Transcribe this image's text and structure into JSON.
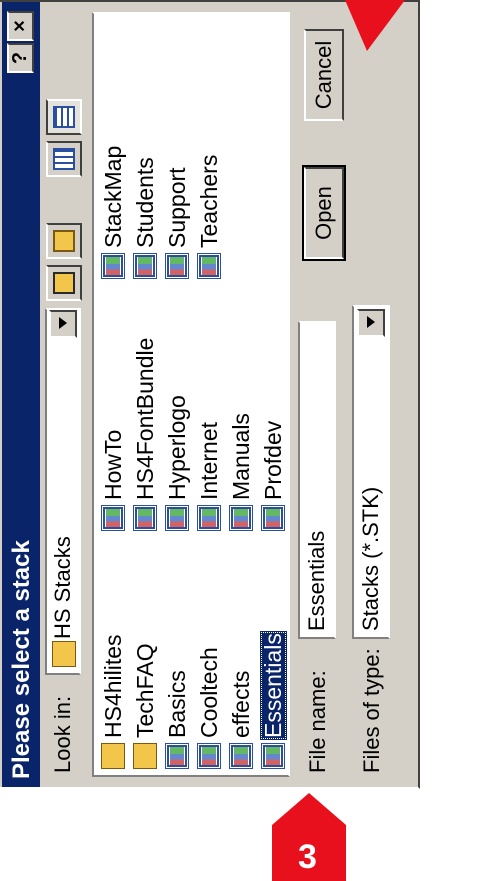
{
  "dialog": {
    "title": "Please select a stack",
    "help_button": "?",
    "close_button": "×"
  },
  "look_in": {
    "label": "Look in:",
    "value": "HS Stacks"
  },
  "toolbar": {
    "icons": [
      "up-one-level-icon",
      "create-new-folder-icon",
      "list-view-icon",
      "details-view-icon"
    ]
  },
  "files": {
    "column1": [
      {
        "name": "HS4hilites",
        "type": "folder"
      },
      {
        "name": "TechFAQ",
        "type": "folder"
      },
      {
        "name": "Basics",
        "type": "stack"
      },
      {
        "name": "Cooltech",
        "type": "stack"
      },
      {
        "name": "effects",
        "type": "stack"
      },
      {
        "name": "Essentials",
        "type": "stack",
        "selected": true
      }
    ],
    "column2": [
      {
        "name": "HowTo",
        "type": "stack"
      },
      {
        "name": "HS4FontBundle",
        "type": "stack"
      },
      {
        "name": "Hyperlogo",
        "type": "stack"
      },
      {
        "name": "Internet",
        "type": "stack"
      },
      {
        "name": "Manuals",
        "type": "stack"
      },
      {
        "name": "Profdev",
        "type": "stack"
      }
    ],
    "column3": [
      {
        "name": "StackMap",
        "type": "stack"
      },
      {
        "name": "Students",
        "type": "stack"
      },
      {
        "name": "Support",
        "type": "stack"
      },
      {
        "name": "Teachers",
        "type": "stack"
      }
    ]
  },
  "file_name": {
    "label": "File name:",
    "value": "Essentials"
  },
  "file_type": {
    "label": "Files of type:",
    "value": "Stacks (*.STK)"
  },
  "buttons": {
    "open": "Open",
    "cancel": "Cancel"
  },
  "annotations": {
    "step_number": "3",
    "marker_color": "#e8101c"
  }
}
